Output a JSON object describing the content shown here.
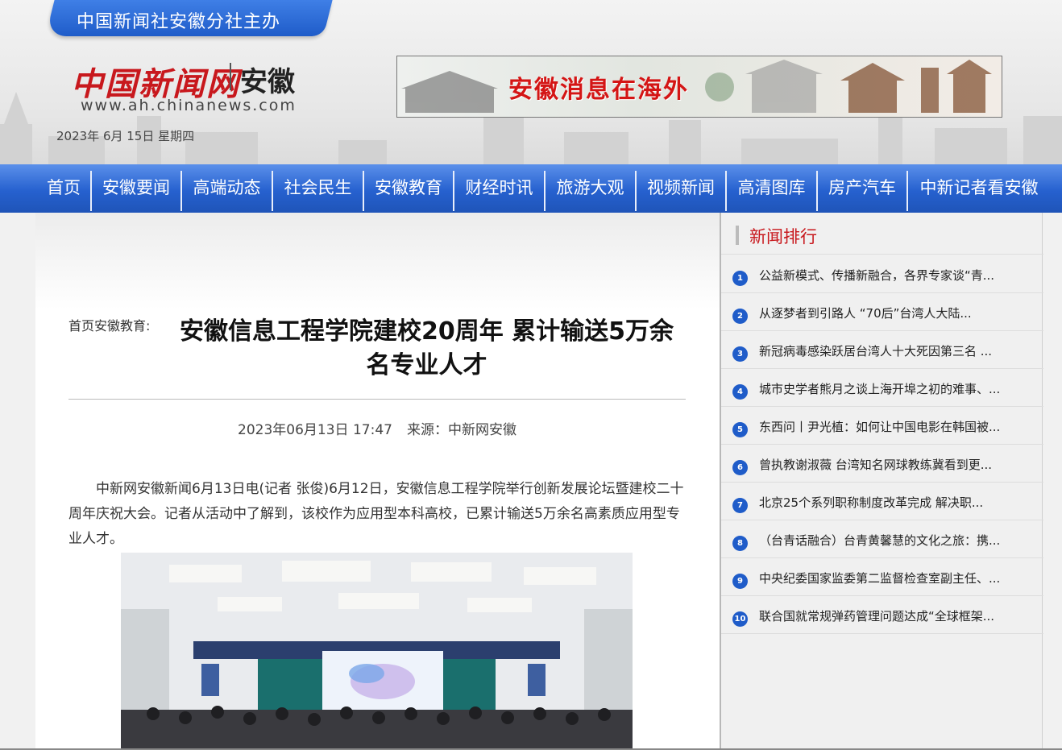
{
  "header": {
    "sponsor": "中国新闻社安徽分社主办",
    "logo_name": "中国新闻网",
    "logo_region": "安徽",
    "logo_url": "www.ah.chinanews.com",
    "date": "2023年 6月 15日   星期四",
    "banner_text": "安徽消息在海外"
  },
  "nav": [
    "首页",
    "安徽要闻",
    "高端动态",
    "社会民生",
    "安徽教育",
    "财经时讯",
    "旅游大观",
    "视频新闻",
    "高清图库",
    "房产汽车",
    "中新记者看安徽"
  ],
  "article": {
    "breadcrumb": "首页安徽教育:",
    "title": "安徽信息工程学院建校20周年 累计输送5万余名专业人才",
    "datetime": "2023年06月13日 17:47",
    "source": "来源：中新网安徽",
    "paragraph": "中新网安徽新闻6月13日电(记者 张俊)6月12日，安徽信息工程学院举行创新发展论坛暨建校二十周年庆祝大会。记者从活动中了解到，该校作为应用型本科高校，已累计输送5万余名高素质应用型专业人才。"
  },
  "ranking": {
    "title": "新闻排行",
    "items": [
      {
        "num": "1",
        "text": "公益新模式、传播新融合，各界专家谈“青..."
      },
      {
        "num": "2",
        "text": "从逐梦者到引路人 “70后”台湾人大陆..."
      },
      {
        "num": "3",
        "text": "新冠病毒感染跃居台湾人十大死因第三名 ..."
      },
      {
        "num": "4",
        "text": "城市史学者熊月之谈上海开埠之初的难事、..."
      },
      {
        "num": "5",
        "text": "东西问丨尹光植：如何让中国电影在韩国被..."
      },
      {
        "num": "6",
        "text": "曾执教谢淑薇 台湾知名网球教练冀看到更..."
      },
      {
        "num": "7",
        "text": "北京25个系列职称制度改革完成 解决职..."
      },
      {
        "num": "8",
        "text": "（台青话融合）台青黄馨慧的文化之旅：携..."
      },
      {
        "num": "9",
        "text": "中央纪委国家监委第二监督检查室副主任、..."
      },
      {
        "num": "10",
        "text": "联合国就常规弹药管理问题达成“全球框架..."
      }
    ]
  },
  "colors": {
    "nav_blue": "#2661cf",
    "accent_red": "#c8181d"
  }
}
